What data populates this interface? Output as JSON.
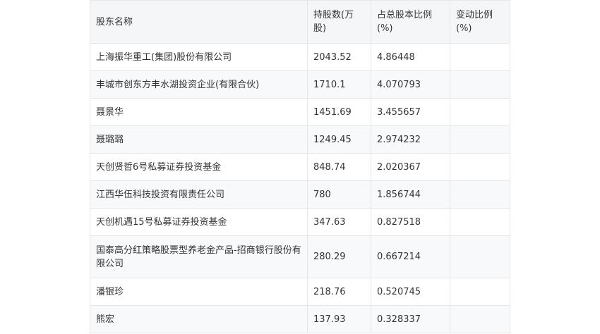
{
  "headers": [
    "股东名称",
    "持股数(万股)",
    "占总股本比例(%)",
    "变动比例(%)"
  ],
  "rows": [
    {
      "name": "上海振华重工(集团)股份有限公司",
      "shares": "2043.52",
      "ratio": "4.86448",
      "change": ""
    },
    {
      "name": "丰城市创东方丰水湖投资企业(有限合伙)",
      "shares": "1710.1",
      "ratio": "4.070793",
      "change": ""
    },
    {
      "name": "聂景华",
      "shares": "1451.69",
      "ratio": "3.455657",
      "change": ""
    },
    {
      "name": "聂璐璐",
      "shares": "1249.45",
      "ratio": "2.974232",
      "change": ""
    },
    {
      "name": "天创贤哲6号私募证券投资基金",
      "shares": "848.74",
      "ratio": "2.020367",
      "change": ""
    },
    {
      "name": "江西华伍科技投资有限责任公司",
      "shares": "780",
      "ratio": "1.856744",
      "change": ""
    },
    {
      "name": "天创机遇15号私募证券投资基金",
      "shares": "347.63",
      "ratio": "0.827518",
      "change": ""
    },
    {
      "name": "国泰高分红策略股票型养老金产品-招商银行股份有限公司",
      "shares": "280.29",
      "ratio": "0.667214",
      "change": ""
    },
    {
      "name": "潘银珍",
      "shares": "218.76",
      "ratio": "0.520745",
      "change": ""
    },
    {
      "name": "熊宏",
      "shares": "137.93",
      "ratio": "0.328337",
      "change": ""
    }
  ]
}
